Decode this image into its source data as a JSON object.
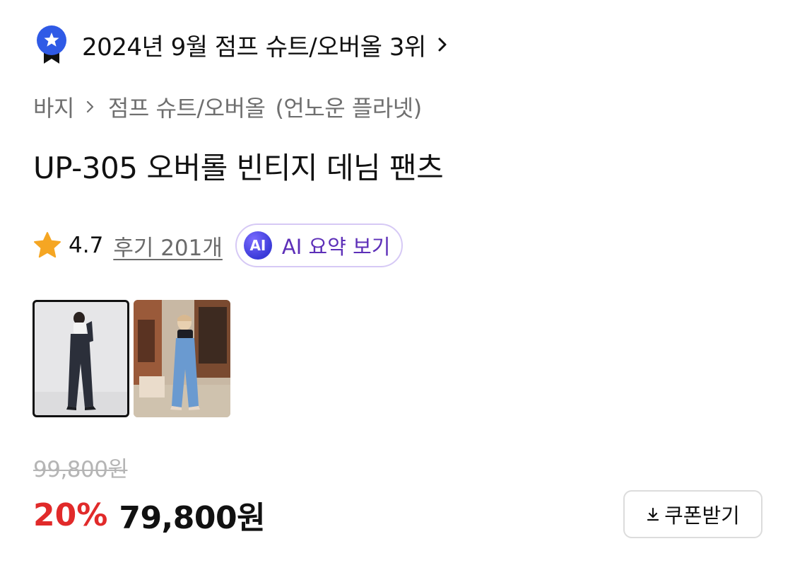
{
  "ranking": {
    "text": "2024년 9월 점프 슈트/오버올 3위",
    "badge_icon": "ribbon-star-badge",
    "badge_color": "#2f5ae6"
  },
  "breadcrumb": {
    "category": "바지",
    "subcategory": "점프 슈트/오버올",
    "brand": "(언노운 플라넷)"
  },
  "product": {
    "title": "UP-305 오버롤 빈티지 데님 팬츠"
  },
  "rating": {
    "score": "4.7",
    "reviews_label": "후기 201개",
    "star_color": "#f5a623"
  },
  "ai_summary": {
    "badge": "AI",
    "label": "AI 요약 보기"
  },
  "thumbnails": [
    {
      "name": "thumb-dark-denim",
      "selected": true
    },
    {
      "name": "thumb-light-denim",
      "selected": false
    }
  ],
  "price": {
    "original": "99,800원",
    "discount": "20%",
    "sale": "79,800원",
    "discount_color": "#e12a2a"
  },
  "coupon": {
    "label": "쿠폰받기",
    "icon": "download-icon"
  }
}
